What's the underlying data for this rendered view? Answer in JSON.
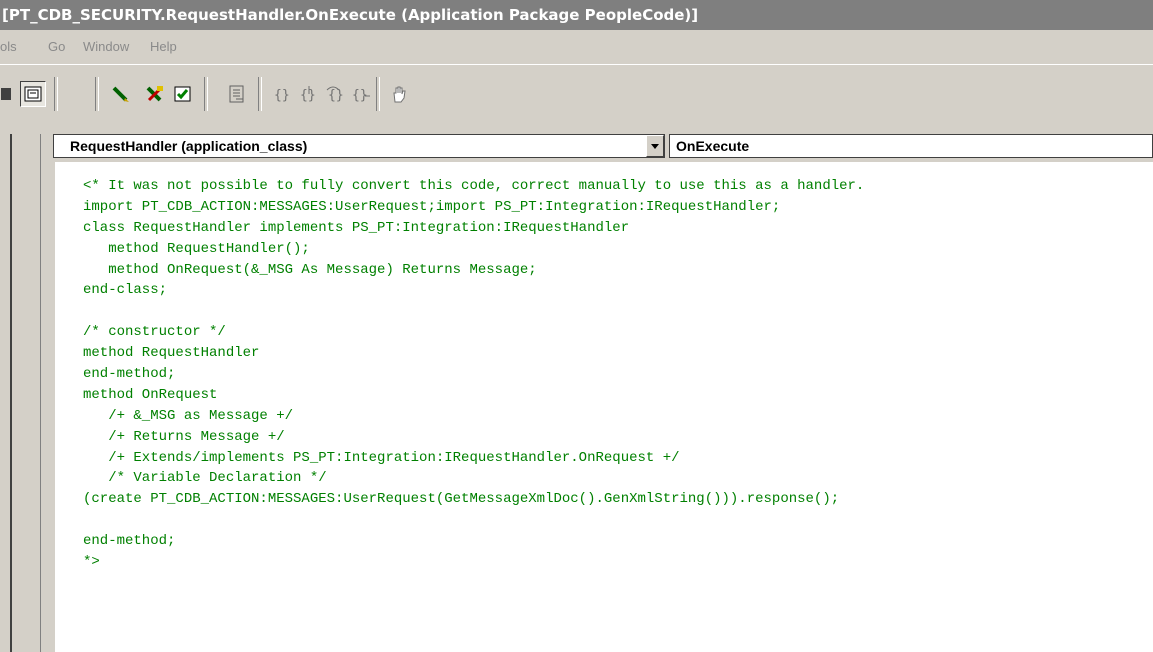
{
  "window": {
    "title": "[PT_CDB_SECURITY.RequestHandler.OnExecute (Application Package PeopleCode)]"
  },
  "menu": {
    "items": [
      "ols",
      "Go",
      "Window",
      "Help"
    ]
  },
  "toolbar": {
    "buttons": [
      "properties-icon",
      "validate-syntax-icon",
      "clear-breakpoints-icon",
      "checkbox-icon",
      "list-icon",
      "go-to-icon",
      "step-into-icon",
      "step-over-icon",
      "step-out-icon",
      "hand-icon"
    ]
  },
  "editor": {
    "object_combo": "RequestHandler   (application_class)",
    "event_combo": "OnExecute",
    "code_color": "#008000",
    "lines": [
      "<* It was not possible to fully convert this code, correct manually to use this as a handler.",
      "import PT_CDB_ACTION:MESSAGES:UserRequest;import PS_PT:Integration:IRequestHandler;",
      "class RequestHandler implements PS_PT:Integration:IRequestHandler",
      "   method RequestHandler();",
      "   method OnRequest(&_MSG As Message) Returns Message;",
      "end-class;",
      "",
      "/* constructor */",
      "method RequestHandler",
      "end-method;",
      "method OnRequest",
      "   /+ &_MSG as Message +/",
      "   /+ Returns Message +/",
      "   /+ Extends/implements PS_PT:Integration:IRequestHandler.OnRequest +/",
      "   /* Variable Declaration */",
      "(create PT_CDB_ACTION:MESSAGES:UserRequest(GetMessageXmlDoc().GenXmlString())).response();",
      "",
      "end-method;",
      "*>"
    ]
  }
}
